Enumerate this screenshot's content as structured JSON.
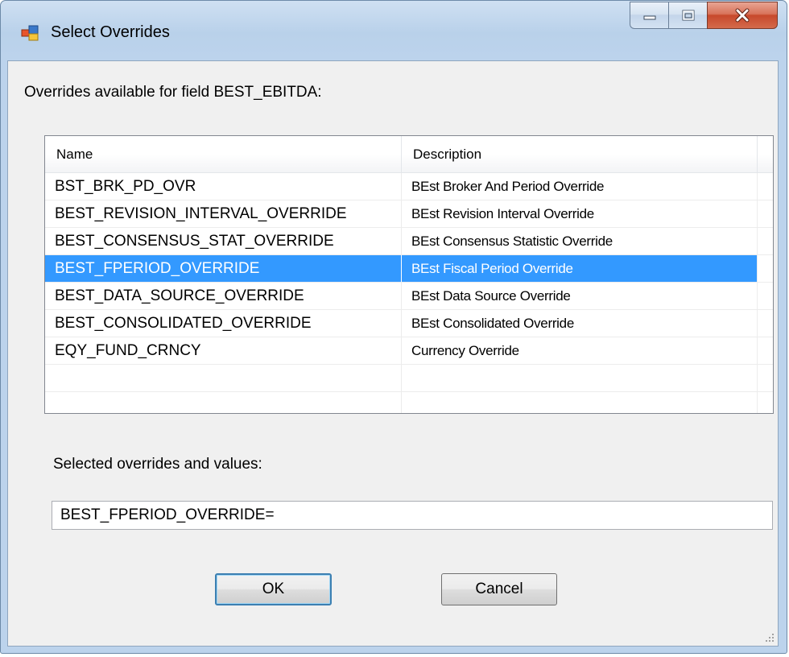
{
  "window": {
    "title": "Select Overrides"
  },
  "dialog": {
    "available_label": "Overrides available for field BEST_EBITDA:",
    "columns": {
      "name": "Name",
      "description": "Description"
    },
    "rows": [
      {
        "name": "BST_BRK_PD_OVR",
        "description": "BEst Broker And Period Override",
        "selected": false
      },
      {
        "name": "BEST_REVISION_INTERVAL_OVERRIDE",
        "description": "BEst Revision Interval Override",
        "selected": false
      },
      {
        "name": "BEST_CONSENSUS_STAT_OVERRIDE",
        "description": "BEst Consensus Statistic Override",
        "selected": false
      },
      {
        "name": "BEST_FPERIOD_OVERRIDE",
        "description": "BEst Fiscal Period Override",
        "selected": true
      },
      {
        "name": "BEST_DATA_SOURCE_OVERRIDE",
        "description": "BEst Data Source Override",
        "selected": false
      },
      {
        "name": "BEST_CONSOLIDATED_OVERRIDE",
        "description": "BEst Consolidated Override",
        "selected": false
      },
      {
        "name": "EQY_FUND_CRNCY",
        "description": "Currency Override",
        "selected": false
      }
    ],
    "selected_label": "Selected overrides and values:",
    "selected_value": "BEST_FPERIOD_OVERRIDE=",
    "ok_label": "OK",
    "cancel_label": "Cancel"
  },
  "colors": {
    "selection": "#3399ff",
    "title_bar": "#bcd3ec",
    "close_button": "#c7492c"
  },
  "icons": {
    "app": "app-window-icon",
    "minimize": "minimize-icon",
    "maximize": "maximize-icon",
    "close": "close-icon",
    "grip": "resize-grip-icon"
  }
}
